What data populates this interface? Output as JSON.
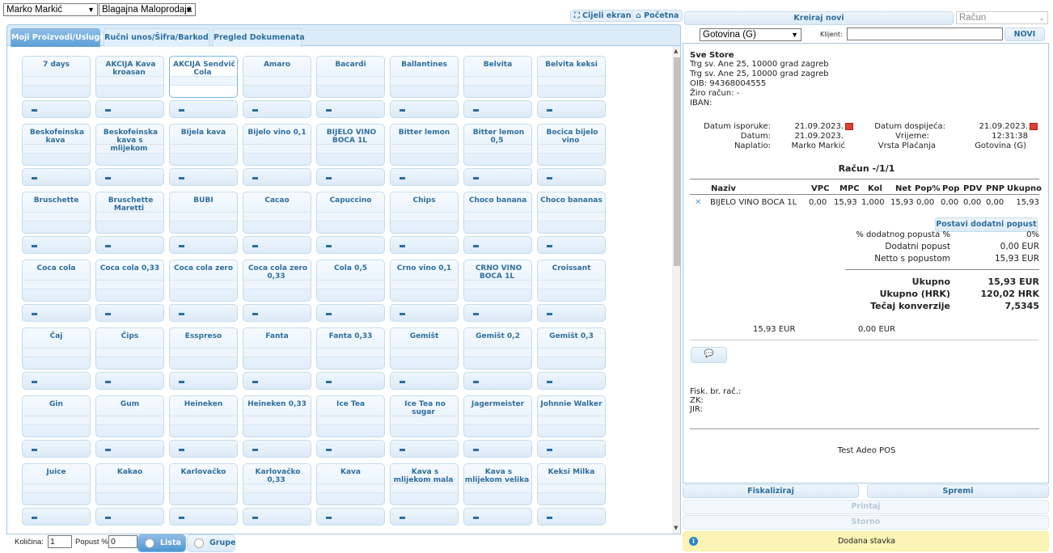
{
  "header": {
    "user_select": "Marko Markić",
    "register_select": "Blagajna Maloprodaja",
    "fullscreen_label": "Cijeli ekran",
    "home_label": "Početna"
  },
  "tabs": [
    "Moji Proizvodi/Usluge",
    "Ručni unos/Šifra/Barkod",
    "Pregled Dokumenata"
  ],
  "products": [
    [
      "7 days",
      "AKCIJA Kava kroasan",
      "AKCIJA Sendvič Cola",
      "Amaro",
      "Bacardi",
      "Ballantines",
      "Belvita",
      "Belvita keksi"
    ],
    [
      "Beskofeinska kava",
      "Beskofeinska kava s mlijekom",
      "Bijela kava",
      "Bijelo vino 0,1",
      "BIJELO VINO BOCA 1L",
      "Bitter lemon",
      "Bitter lemon 0,5",
      "Bocica bijelo vino"
    ],
    [
      "Bruschette",
      "Bruschette Maretti",
      "BUBI",
      "Cacao",
      "Capuccino",
      "Chips",
      "Choco banana",
      "Choco bananas"
    ],
    [
      "Coca cola",
      "Coca cola 0,33",
      "Coca cola zero",
      "Coca cola zero 0,33",
      "Cola 0,5",
      "Crno vino 0,1",
      "CRNO VINO BOCA 1L",
      "Croissant"
    ],
    [
      "Čaj",
      "Čips",
      "Esspreso",
      "Fanta",
      "Fanta 0,33",
      "Gemišt",
      "Gemišt 0,2",
      "Gemišt 0,3"
    ],
    [
      "Gin",
      "Gum",
      "Heineken",
      "Heineken 0,33",
      "Ice Tea",
      "Ice Tea no sugar",
      "Jagermeister",
      "Johnnie Walker"
    ],
    [
      "Juice",
      "Kakao",
      "Karlovačko",
      "Karlovačko 0,33",
      "Kava",
      "Kava s mlijekom mala",
      "Kava s mlijekom velika",
      "Keksi Milka"
    ]
  ],
  "bottom": {
    "kolicina_label": "Količina:",
    "kolicina_value": "1",
    "popust_label": "Popust %:",
    "popust_value": "0",
    "lista_label": "Lista",
    "grupe_label": "Grupe"
  },
  "right": {
    "kreiraj_label": "Kreiraj novi",
    "doc_type": "Račun",
    "payment_select": "Gotovina (G)",
    "klijent_label": "Klijent:",
    "klijent_value": "",
    "novi_label": "NOVI",
    "store": {
      "name": "Sve Store",
      "addr1": "Trg sv. Ane 25, 10000 grad zagreb",
      "addr2": "Trg sv. Ane 25, 10000 grad zagreb",
      "oib": "OIB: 94368004555",
      "ziro": "Žiro račun: -",
      "iban": "IBAN:"
    },
    "meta": {
      "isporuke_label": "Datum isporuke:",
      "isporuke_value": "21.09.2023.",
      "dospijeca_label": "Datum dospijeća:",
      "dospijeca_value": "21.09.2023.",
      "datum_label": "Datum:",
      "datum_value": "21.09.2023.",
      "vrijeme_label": "Vrijeme:",
      "vrijeme_value": "12:31:38",
      "naplatio_label": "Naplatio:",
      "naplatio_value": "Marko Markić",
      "vrsta_label": "Vrsta Plaćanja",
      "vrsta_value": "Gotovina (G)"
    },
    "invoice_title": "Račun -/1/1",
    "columns": [
      "Naziv",
      "VPC",
      "MPC",
      "Kol",
      "Net",
      "Pop%",
      "Pop",
      "PDV",
      "PNP",
      "Ukupno"
    ],
    "row": [
      "BIJELO VINO BOCA 1L",
      "0,00",
      "15,93",
      "1,000",
      "15,93",
      "0,00",
      "0,00",
      "0,00",
      "0,00",
      "15,93"
    ],
    "postavi_label": "Postavi dodatni popust",
    "summary": {
      "dodatni_pct_label": "% dodatnog popusta %",
      "dodatni_pct_value": "0%",
      "dodatni_label": "Dodatni popust",
      "dodatni_value": "0,00 EUR",
      "netto_label": "Netto s popustom",
      "netto_value": "15,93 EUR",
      "ukupno_label": "Ukupno",
      "ukupno_value": "15,93 EUR",
      "ukupno_hrk_label": "Ukupno (HRK)",
      "ukupno_hrk_value": "120,02 HRK",
      "tecaj_label": "Tečaj konverzije",
      "tecaj_value": "7,5345"
    },
    "totals": {
      "eur": "15,93 EUR",
      "zero": "0,00 EUR"
    },
    "fisk": {
      "line1": "Fisk. br. rač.:",
      "line2": "ZK:",
      "line3": "JIR:"
    },
    "footer": "Test Adeo POS",
    "actions": {
      "fiskaliziraj": "Fiskaliziraj",
      "spremi": "Spremi",
      "printaj": "Printaj",
      "storno": "Storno"
    },
    "notice": "Dodana stavka"
  },
  "colors": {
    "accent": "#2e6e9e",
    "tab_active": "#5a9fd6",
    "notice_bg": "#fbf4b4"
  }
}
